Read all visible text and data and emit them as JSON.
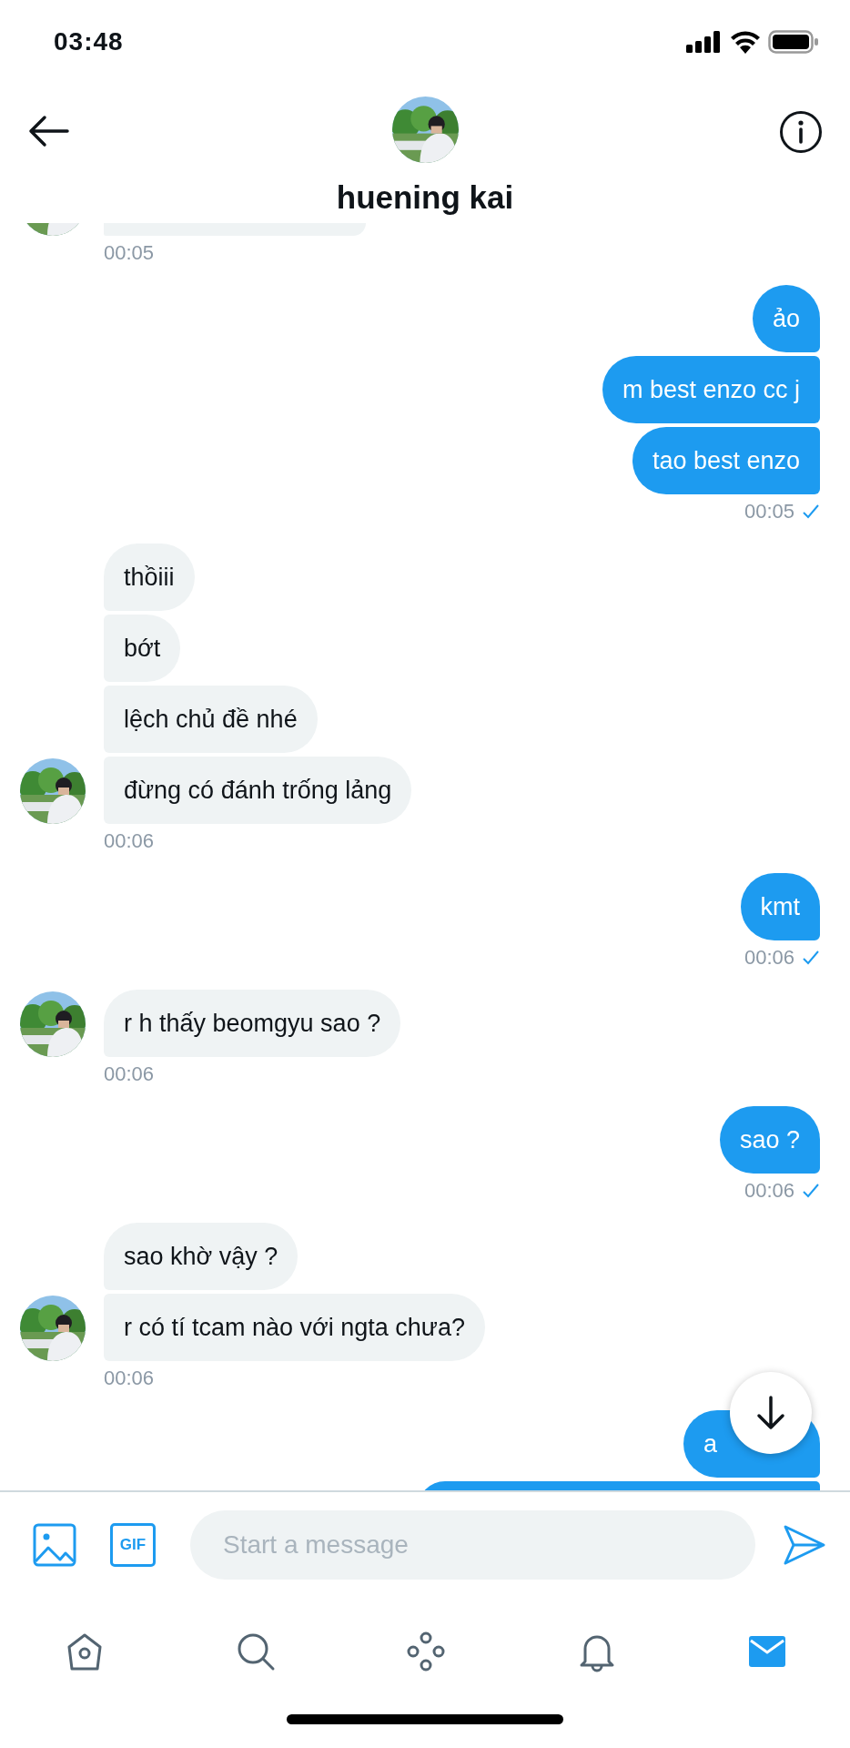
{
  "status_bar": {
    "time": "03:48"
  },
  "header": {
    "name": "huening kai"
  },
  "messages": [
    {
      "kind": "received",
      "time": "00:05"
    },
    {
      "kind": "sent",
      "texts": [
        "ảo",
        "m best enzo cc j",
        "tao best enzo"
      ],
      "time": "00:05",
      "read": true
    },
    {
      "kind": "received",
      "texts": [
        "thồiii",
        "bớt",
        "lệch chủ đề nhé",
        "đừng có đánh trống lảng"
      ],
      "time": "00:06"
    },
    {
      "kind": "sent",
      "texts": [
        "kmt"
      ],
      "time": "00:06",
      "read": true
    },
    {
      "kind": "received",
      "texts": [
        "r h thấy beomgyu sao ?"
      ],
      "time": "00:06"
    },
    {
      "kind": "sent",
      "texts": [
        "sao ?"
      ],
      "time": "00:06",
      "read": true
    },
    {
      "kind": "received",
      "texts": [
        "sao khờ vậy ?",
        "r có tí tcam nào với ngta chưa?"
      ],
      "time": "00:06"
    },
    {
      "kind": "sent",
      "texts": [
        "a"
      ],
      "continues": true
    }
  ],
  "composer": {
    "gif_label": "GIF",
    "placeholder": "Start a message"
  },
  "tabs": [
    {
      "kind": "home",
      "selected": false
    },
    {
      "kind": "search",
      "selected": false
    },
    {
      "kind": "spaces",
      "selected": false
    },
    {
      "kind": "notifications",
      "selected": false
    },
    {
      "kind": "messages",
      "selected": true
    }
  ]
}
